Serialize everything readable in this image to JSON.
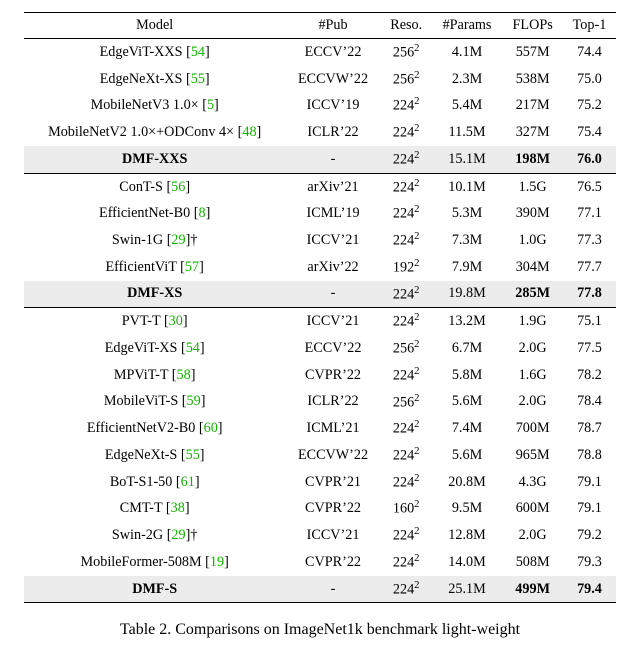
{
  "headers": [
    "Model",
    "#Pub",
    "Reso.",
    "#Params",
    "FLOPs",
    "Top-1"
  ],
  "caption": "Table 2. Comparisons on ImageNet1k benchmark light-weight",
  "groups": [
    {
      "rows": [
        {
          "model": "EdgeViT-XXS",
          "ref": "54",
          "pub": "ECCV’22",
          "reso": "256",
          "resoExp": "2",
          "params": "4.1M",
          "flops": "557M",
          "top1": "74.4"
        },
        {
          "model": "EdgeNeXt-XS",
          "ref": "55",
          "pub": "ECCVW’22",
          "reso": "256",
          "resoExp": "2",
          "params": "2.3M",
          "flops": "538M",
          "top1": "75.0"
        },
        {
          "model": "MobileNetV3 1.0×",
          "ref": "5",
          "pub": "ICCV’19",
          "reso": "224",
          "resoExp": "2",
          "params": "5.4M",
          "flops": "217M",
          "top1": "75.2"
        },
        {
          "model": "MobileNetV2 1.0×+ODConv 4×",
          "ref": "48",
          "pub": "ICLR’22",
          "reso": "224",
          "resoExp": "2",
          "params": "11.5M",
          "flops": "327M",
          "top1": "75.4"
        }
      ],
      "highlight": {
        "model": "DMF-XXS",
        "pub": "-",
        "reso": "224",
        "resoExp": "2",
        "params": "15.1M",
        "flops": "198M",
        "top1": "76.0"
      }
    },
    {
      "rows": [
        {
          "model": "ConT-S",
          "ref": "56",
          "pub": "arXiv’21",
          "reso": "224",
          "resoExp": "2",
          "params": "10.1M",
          "flops": "1.5G",
          "top1": "76.5"
        },
        {
          "model": "EfficientNet-B0",
          "ref": "8",
          "pub": "ICML’19",
          "reso": "224",
          "resoExp": "2",
          "params": "5.3M",
          "flops": "390M",
          "top1": "77.1"
        },
        {
          "model": "Swin-1G",
          "ref": "29",
          "dagger": true,
          "pub": "ICCV’21",
          "reso": "224",
          "resoExp": "2",
          "params": "7.3M",
          "flops": "1.0G",
          "top1": "77.3"
        },
        {
          "model": "EfficientViT",
          "ref": "57",
          "pub": "arXiv’22",
          "reso": "192",
          "resoExp": "2",
          "params": "7.9M",
          "flops": "304M",
          "top1": "77.7"
        }
      ],
      "highlight": {
        "model": "DMF-XS",
        "pub": "-",
        "reso": "224",
        "resoExp": "2",
        "params": "19.8M",
        "flops": "285M",
        "top1": "77.8"
      }
    },
    {
      "rows": [
        {
          "model": "PVT-T",
          "ref": "30",
          "pub": "ICCV’21",
          "reso": "224",
          "resoExp": "2",
          "params": "13.2M",
          "flops": "1.9G",
          "top1": "75.1"
        },
        {
          "model": "EdgeViT-XS",
          "ref": "54",
          "pub": "ECCV’22",
          "reso": "256",
          "resoExp": "2",
          "params": "6.7M",
          "flops": "2.0G",
          "top1": "77.5"
        },
        {
          "model": "MPViT-T",
          "ref": "58",
          "pub": "CVPR’22",
          "reso": "224",
          "resoExp": "2",
          "params": "5.8M",
          "flops": "1.6G",
          "top1": "78.2"
        },
        {
          "model": "MobileViT-S",
          "ref": "59",
          "pub": "ICLR’22",
          "reso": "256",
          "resoExp": "2",
          "params": "5.6M",
          "flops": "2.0G",
          "top1": "78.4"
        },
        {
          "model": "EfficientNetV2-B0",
          "ref": "60",
          "pub": "ICML’21",
          "reso": "224",
          "resoExp": "2",
          "params": "7.4M",
          "flops": "700M",
          "top1": "78.7"
        },
        {
          "model": "EdgeNeXt-S",
          "ref": "55",
          "pub": "ECCVW’22",
          "reso": "224",
          "resoExp": "2",
          "params": "5.6M",
          "flops": "965M",
          "top1": "78.8"
        },
        {
          "model": "BoT-S1-50",
          "ref": "61",
          "pub": "CVPR’21",
          "reso": "224",
          "resoExp": "2",
          "params": "20.8M",
          "flops": "4.3G",
          "top1": "79.1"
        },
        {
          "model": "CMT-T",
          "ref": "38",
          "pub": "CVPR’22",
          "reso": "160",
          "resoExp": "2",
          "params": "9.5M",
          "flops": "600M",
          "top1": "79.1"
        },
        {
          "model": "Swin-2G",
          "ref": "29",
          "dagger": true,
          "pub": "ICCV’21",
          "reso": "224",
          "resoExp": "2",
          "params": "12.8M",
          "flops": "2.0G",
          "top1": "79.2"
        },
        {
          "model": "MobileFormer-508M",
          "ref": "19",
          "pub": "CVPR’22",
          "reso": "224",
          "resoExp": "2",
          "params": "14.0M",
          "flops": "508M",
          "top1": "79.3"
        }
      ],
      "highlight": {
        "model": "DMF-S",
        "pub": "-",
        "reso": "224",
        "resoExp": "2",
        "params": "25.1M",
        "flops": "499M",
        "top1": "79.4"
      }
    }
  ],
  "chart_data": {
    "type": "table",
    "title": "Table 2. Comparisons on ImageNet1k benchmark (light-weight models)",
    "columns": [
      "Model",
      "#Pub",
      "Reso.",
      "#Params",
      "FLOPs",
      "Top-1"
    ],
    "rows": [
      [
        "EdgeViT-XXS",
        "ECCV’22",
        "256^2",
        "4.1M",
        "557M",
        74.4
      ],
      [
        "EdgeNeXt-XS",
        "ECCVW’22",
        "256^2",
        "2.3M",
        "538M",
        75.0
      ],
      [
        "MobileNetV3 1.0×",
        "ICCV’19",
        "224^2",
        "5.4M",
        "217M",
        75.2
      ],
      [
        "MobileNetV2 1.0×+ODConv 4×",
        "ICLR’22",
        "224^2",
        "11.5M",
        "327M",
        75.4
      ],
      [
        "DMF-XXS",
        "-",
        "224^2",
        "15.1M",
        "198M",
        76.0
      ],
      [
        "ConT-S",
        "arXiv’21",
        "224^2",
        "10.1M",
        "1.5G",
        76.5
      ],
      [
        "EfficientNet-B0",
        "ICML’19",
        "224^2",
        "5.3M",
        "390M",
        77.1
      ],
      [
        "Swin-1G",
        "ICCV’21",
        "224^2",
        "7.3M",
        "1.0G",
        77.3
      ],
      [
        "EfficientViT",
        "arXiv’22",
        "192^2",
        "7.9M",
        "304M",
        77.7
      ],
      [
        "DMF-XS",
        "-",
        "224^2",
        "19.8M",
        "285M",
        77.8
      ],
      [
        "PVT-T",
        "ICCV’21",
        "224^2",
        "13.2M",
        "1.9G",
        75.1
      ],
      [
        "EdgeViT-XS",
        "ECCV’22",
        "256^2",
        "6.7M",
        "2.0G",
        77.5
      ],
      [
        "MPViT-T",
        "CVPR’22",
        "224^2",
        "5.8M",
        "1.6G",
        78.2
      ],
      [
        "MobileViT-S",
        "ICLR’22",
        "256^2",
        "5.6M",
        "2.0G",
        78.4
      ],
      [
        "EfficientNetV2-B0",
        "ICML’21",
        "224^2",
        "7.4M",
        "700M",
        78.7
      ],
      [
        "EdgeNeXt-S",
        "ECCVW’22",
        "224^2",
        "5.6M",
        "965M",
        78.8
      ],
      [
        "BoT-S1-50",
        "CVPR’21",
        "224^2",
        "20.8M",
        "4.3G",
        79.1
      ],
      [
        "CMT-T",
        "CVPR’22",
        "160^2",
        "9.5M",
        "600M",
        79.1
      ],
      [
        "Swin-2G",
        "ICCV’21",
        "224^2",
        "12.8M",
        "2.0G",
        79.2
      ],
      [
        "MobileFormer-508M",
        "CVPR’22",
        "224^2",
        "14.0M",
        "508M",
        79.3
      ],
      [
        "DMF-S",
        "-",
        "224^2",
        "25.1M",
        "499M",
        79.4
      ]
    ]
  }
}
